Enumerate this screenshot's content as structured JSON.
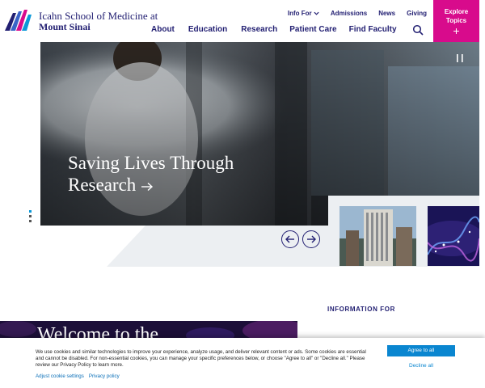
{
  "header": {
    "logo_line1": "Icahn School of Medicine at",
    "logo_line2": "Mount Sinai",
    "utility": {
      "info_for": "Info For",
      "admissions": "Admissions",
      "news": "News",
      "giving": "Giving"
    },
    "nav": [
      "About",
      "Education",
      "Research",
      "Patient Care",
      "Find Faculty"
    ],
    "explore": {
      "line1": "Explore",
      "line2": "Topics",
      "plus": "+"
    }
  },
  "hero": {
    "line1": "Saving Lives Through",
    "line2": "Research"
  },
  "section": {
    "info_for_heading": "INFORMATION FOR",
    "welcome_heading": "Welcome to the"
  },
  "cookie": {
    "text": "We use cookies and similar technologies to improve your experience, analyze usage, and deliver relevant content or ads. Some cookies are essential and cannot be disabled. For non-essential cookies, you can manage your specific preferences below, or choose \"Agree to all\" or \"Decline all.\" Please review our Privacy Policy to learn more.",
    "adjust_link": "Adjust cookie settings",
    "privacy_link": "Privacy policy",
    "agree_label": "Agree to all",
    "decline_label": "Decline all"
  },
  "colors": {
    "brand_navy": "#221f72",
    "brand_magenta": "#d80b8c",
    "accent_blue": "#0a86d0"
  }
}
